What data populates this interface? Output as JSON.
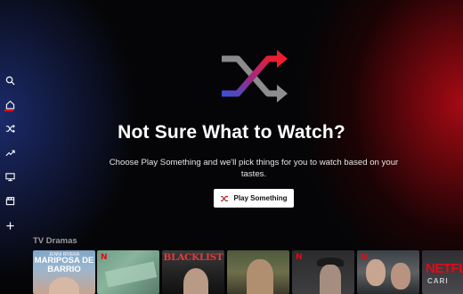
{
  "sidebar": {
    "items": [
      {
        "name": "search",
        "icon": "search-icon"
      },
      {
        "name": "home",
        "icon": "home-icon",
        "active": true
      },
      {
        "name": "play-something",
        "icon": "shuffle-icon"
      },
      {
        "name": "trending",
        "icon": "trending-icon"
      },
      {
        "name": "tv",
        "icon": "tv-icon"
      },
      {
        "name": "movies",
        "icon": "clapperboard-icon"
      },
      {
        "name": "my-list",
        "icon": "plus-icon"
      }
    ],
    "active_color": "#e50914"
  },
  "hero": {
    "logo_icon": "shuffle-icon",
    "title": "Not Sure What to Watch?",
    "subtitle": "Choose Play Something and we'll pick things for you to watch based on your tastes.",
    "button_label": "Play Something"
  },
  "row": {
    "title": "TV Dramas",
    "cards": [
      {
        "name": "card-mariposa-de-barrio",
        "badge": "",
        "line1": "JENNI RIVERA",
        "line2": "MARIPOSA DE BARRIO"
      },
      {
        "name": "card-money-show",
        "badge": "N"
      },
      {
        "name": "card-blacklist",
        "badge": "",
        "line1": "BLACKLIST"
      },
      {
        "name": "card-soldier-show",
        "badge": ""
      },
      {
        "name": "card-peaky-show",
        "badge": "N"
      },
      {
        "name": "card-drama-couple",
        "badge": "N"
      },
      {
        "name": "card-netflix-show",
        "badge": "",
        "line1": "NETFL",
        "line2": "CARI"
      }
    ]
  },
  "colors": {
    "brand_red": "#e50914",
    "accent_blue": "#3b4fd6"
  }
}
